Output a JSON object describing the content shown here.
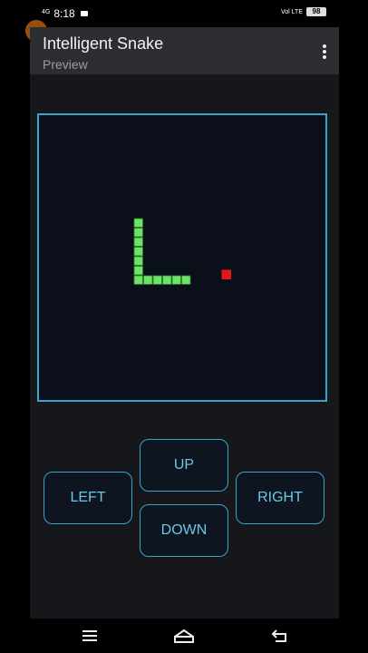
{
  "status": {
    "network": "4G",
    "time": "8:18",
    "lte": "Vol LTE",
    "battery": "98"
  },
  "app": {
    "title": "Intelligent Snake",
    "subtitle": "Preview"
  },
  "game": {
    "snake_segments": [
      [
        0,
        0
      ],
      [
        0,
        1
      ],
      [
        0,
        2
      ],
      [
        0,
        3
      ],
      [
        0,
        4
      ],
      [
        0,
        5
      ],
      [
        0,
        6
      ],
      [
        1,
        6
      ],
      [
        2,
        6
      ],
      [
        3,
        6
      ],
      [
        4,
        6
      ],
      [
        5,
        6
      ]
    ],
    "food": [
      9,
      5
    ],
    "colors": {
      "snake": "#6ee36a",
      "snake_outline": "#2f7a2c",
      "food": "#e01818",
      "board_border": "#3aa3c8"
    }
  },
  "controls": {
    "up": "UP",
    "left": "LEFT",
    "right": "RIGHT",
    "down": "DOWN"
  },
  "nav": {
    "menu_icon": "menu-icon",
    "home_icon": "home-icon",
    "back_icon": "back-icon"
  }
}
